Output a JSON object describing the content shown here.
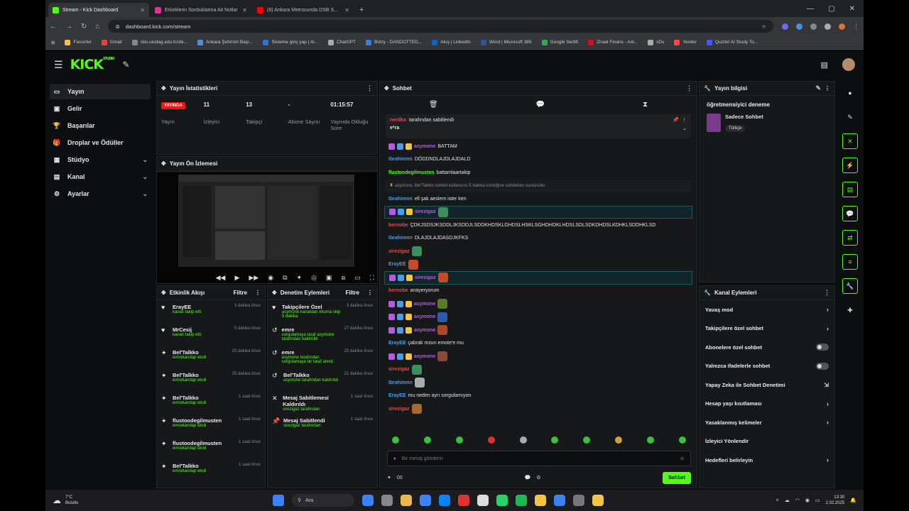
{
  "browser": {
    "tabs": [
      {
        "label": "Stream - Kick Dashboard",
        "color": "#53fc18",
        "active": true
      },
      {
        "label": "Erkeklerin Sorduklarina Ait Notlar",
        "color": "#d43b8a",
        "active": false
      },
      {
        "label": "(8) Ankara Metrosunda DSB S...",
        "color": "#ff0000",
        "active": false
      }
    ],
    "new_tab": "+",
    "url": "dashboard.kick.com/stream",
    "bookmarks": [
      {
        "label": "Favoriler",
        "color": "#f4c542"
      },
      {
        "label": "Gmail",
        "color": "#ea4335"
      },
      {
        "label": "obs.uludag.edu.tr/obi...",
        "color": "#888888"
      },
      {
        "label": "Ankara Şehrinin Başı...",
        "color": "#4a90e2"
      },
      {
        "label": "Sisteme giriş yap | Al...",
        "color": "#2a74d6"
      },
      {
        "label": "ChatGPT",
        "color": "#aaaaaa"
      },
      {
        "label": "Bolzy - DASDOTTED...",
        "color": "#3b7dd8"
      },
      {
        "label": "Akış | LinkedIn",
        "color": "#0a66c2"
      },
      {
        "label": "Word | Microsoft 365",
        "color": "#2b579a"
      },
      {
        "label": "Google Sertifi",
        "color": "#34a853"
      },
      {
        "label": "Ziraat Finans - Anl...",
        "color": "#e30a17"
      },
      {
        "label": "xDs",
        "color": "#aaaaaa"
      },
      {
        "label": "Yeniler",
        "color": "#ff4444"
      },
      {
        "label": "Quizlet AI Study To...",
        "color": "#4255ff"
      }
    ]
  },
  "header": {
    "logo": "KICK",
    "logo_sup": "STUDIO"
  },
  "nav": {
    "items": [
      {
        "label": "Yayın",
        "icon": "▭",
        "active": true,
        "chev": ""
      },
      {
        "label": "Gelir",
        "icon": "▣",
        "active": false,
        "chev": ""
      },
      {
        "label": "Başarılar",
        "icon": "🏆",
        "active": false,
        "chev": ""
      },
      {
        "label": "Droplar ve Ödüller",
        "icon": "🎁",
        "active": false,
        "chev": ""
      },
      {
        "label": "Stüdyo",
        "icon": "▦",
        "active": false,
        "chev": "⌄"
      },
      {
        "label": "Kanal",
        "icon": "▤",
        "active": false,
        "chev": "⌄"
      },
      {
        "label": "Ayarlar",
        "icon": "⚙",
        "active": false,
        "chev": "⌄"
      }
    ]
  },
  "stats": {
    "title": "Yayın İstatistikleri",
    "items": [
      {
        "value": "YAYINDA",
        "label": "Yayın"
      },
      {
        "value": "11",
        "label": "İzleyici"
      },
      {
        "value": "13",
        "label": "Takipçi"
      },
      {
        "value": "-",
        "label": "Abone Sayısı"
      },
      {
        "value": "01:15:57",
        "label": "Yayında Olduğu Süre"
      }
    ]
  },
  "preview": {
    "title": "Yayın Ön İzlemesi"
  },
  "activity": {
    "title": "Etkinlik Akışı",
    "filter": "Filtre",
    "items": [
      {
        "name": "ErayEE",
        "sub": "kanalı takip etti",
        "time": "3 dakika önce",
        "icon": "♥"
      },
      {
        "name": "MrCesij",
        "sub": "kanalı takip etti",
        "time": "5 dakika önce",
        "icon": "♥"
      },
      {
        "name": "Bel'Talkko",
        "sub": "emrekandap ekoli",
        "time": "25 dakika önce",
        "icon": "✦"
      },
      {
        "name": "Bel'Talkko",
        "sub": "emrekandap ekoli",
        "time": "25 dakika önce",
        "icon": "✦"
      },
      {
        "name": "Bel'Talkko",
        "sub": "emrekandap ekoli",
        "time": "1 saat önce",
        "icon": "✦"
      },
      {
        "name": "flustoodegilmusten",
        "sub": "emrekandap ekoli",
        "time": "1 saat önce",
        "icon": "✦"
      },
      {
        "name": "flustoodegilmusten",
        "sub": "emrekandap ekoli",
        "time": "1 saat önce",
        "icon": "✦"
      },
      {
        "name": "Bel'Talkko",
        "sub": "emrekandap ekoli",
        "time": "1 saat önce",
        "icon": "✦"
      }
    ]
  },
  "modact": {
    "title": "Denetim Eylemleri",
    "filter": "Filtre",
    "items": [
      {
        "name": "Takipçilere Özel",
        "sub": "asymone kanaldan okuma skip 5 dakika",
        "time": "3 dakika önce",
        "icon": "♥"
      },
      {
        "name": "emre",
        "sub": "sorgulamaya taraf asymone tarafından kaldırıldı",
        "time": "27 dakika önce",
        "icon": "↺"
      },
      {
        "name": "emre",
        "sub": "asymone tarafından sorgulamaya bir taraf alındı",
        "time": "25 dakika önce",
        "icon": "↺"
      },
      {
        "name": "Bel'Talkko",
        "sub": "asymone tarafından kaldırıldı",
        "time": "21 dakika önce",
        "icon": "↺"
      },
      {
        "name": "Mesaj Sabitlemesi Kaldırıldı",
        "sub": "sirezigaz tarafından",
        "time": "1 saat önce",
        "icon": "✕"
      },
      {
        "name": "Mesaj Sabitlendi",
        "sub": "sirezigaz tarafından",
        "time": "1 saat önce",
        "icon": "📌"
      }
    ]
  },
  "chat": {
    "title": "Sohbet",
    "pinned": {
      "user": "nerdka",
      "text": "tarafından sabitlendi",
      "msg": "e*ra"
    },
    "messages": [
      {
        "user": "asymone",
        "uc": "#b25ce6",
        "text": "BATTAM",
        "type": "n",
        "emote": ""
      },
      {
        "user": "Ibrahimnn",
        "uc": "#4a9de0",
        "text": "DÖDDNDLAJDLAJDALD",
        "type": "n",
        "emote": ""
      },
      {
        "user": "flustoodegilmusten",
        "uc": "#53fc18",
        "text": "battamlaartakip",
        "type": "n",
        "emote": ""
      },
      {
        "user": "",
        "uc": "#888",
        "text": "asymone, Bel'Talkko sohbet kullanıcısı 5 dakika süreliğine sohbetten susturuldu",
        "type": "sys",
        "emote": ""
      },
      {
        "user": "Ibrahimnn",
        "uc": "#4a9de0",
        "text": "ell şak aeslem ister ken",
        "type": "n",
        "emote": ""
      },
      {
        "user": "sirezigaz",
        "uc": "#b25ce6",
        "text": "",
        "type": "hl",
        "emote": "#3c8f5a"
      },
      {
        "user": "bernobe",
        "uc": "#e24b4b",
        "text": "ÇDKJSDSJKSDDLJKSDDJLSDDKHDSKLGHDSLHSKLSGHDHDKLHDSLSDLSDKDHDSLKDHKLSDDHKLSD",
        "type": "n",
        "emote": ""
      },
      {
        "user": "Ibrahimnn",
        "uc": "#4a9de0",
        "text": "DLAJDLAJDASDJKFKS",
        "type": "n",
        "emote": ""
      },
      {
        "user": "sirezigaz",
        "uc": "#e24b4b",
        "text": "",
        "type": "n",
        "emote": "#3c8f5a"
      },
      {
        "user": "ErayEE",
        "uc": "#4a9de0",
        "text": "",
        "type": "n",
        "emote": "#c44a2a"
      },
      {
        "user": "sirezigaz",
        "uc": "#b25ce6",
        "text": "",
        "type": "hl",
        "emote": "#c44a2a"
      },
      {
        "user": "bernobe",
        "uc": "#e24b4b",
        "text": "anayeryorum",
        "type": "n",
        "emote": ""
      },
      {
        "user": "asymone",
        "uc": "#b25ce6",
        "text": "",
        "type": "n",
        "emote": "#5c7a2a"
      },
      {
        "user": "asymone",
        "uc": "#b25ce6",
        "text": "",
        "type": "n",
        "emote": "#2a5ca8"
      },
      {
        "user": "asymone",
        "uc": "#b25ce6",
        "text": "",
        "type": "n",
        "emote": "#a84a2a"
      },
      {
        "user": "ErayEE",
        "uc": "#4a9de0",
        "text": "çabrak mısın emote'e mu",
        "type": "n",
        "emote": ""
      },
      {
        "user": "asymone",
        "uc": "#b25ce6",
        "text": "",
        "type": "n",
        "emote": "#8a4a3a"
      },
      {
        "user": "sirezigaz",
        "uc": "#e24b4b",
        "text": "",
        "type": "n",
        "emote": "#3c8f5a"
      },
      {
        "user": "Ibrahimnn",
        "uc": "#4a9de0",
        "text": "",
        "type": "n",
        "emote": "#aaaaaa"
      },
      {
        "user": "ErayEE",
        "uc": "#4a9de0",
        "text": "mu neden ayrı sorgulamıyon",
        "type": "n",
        "emote": ""
      },
      {
        "user": "sirezigaz",
        "uc": "#e24b4b",
        "text": "",
        "type": "n",
        "emote": "#a86a2a"
      }
    ],
    "emote_colors": [
      "#3cbf3c",
      "#3cbf3c",
      "#3cbf3c",
      "#d33",
      "#aaa",
      "#3cbf3c",
      "#3cbf3c",
      "#c9a23a",
      "#3cbf3c",
      "#3cbf3c"
    ],
    "placeholder": "Bir mesaj gönderin",
    "count": "00",
    "send": "Sohbet"
  },
  "sinfo": {
    "title": "Yayın bilgisi",
    "stream_title": "öğretmensiyici deneme",
    "category": "Sadece Sohbet",
    "tag": "Türkçe"
  },
  "actions": {
    "title": "Kanal Eylemleri",
    "items": [
      {
        "label": "Yavaş mod",
        "ctl": "chev"
      },
      {
        "label": "Takipçilere özel sohbet",
        "ctl": "chev"
      },
      {
        "label": "Abonelere özel sohbet",
        "ctl": "toggle"
      },
      {
        "label": "Yalnızca ifadelerle sohbet",
        "ctl": "toggle"
      },
      {
        "label": "Yapay Zeka ile Sohbet Denetimi",
        "ctl": "ext"
      },
      {
        "label": "Hesap yaşı kısıtlaması",
        "ctl": "chev"
      },
      {
        "label": "Yasaklanmış kelimeler",
        "ctl": "chev"
      },
      {
        "label": "İzleyici Yönlendir",
        "ctl": "none"
      },
      {
        "label": "Hedefleri belirleyin",
        "ctl": "chev"
      }
    ]
  },
  "taskbar": {
    "temp": "7°C",
    "weather": "Bulutlu",
    "search": "Ara",
    "time": "13:30",
    "date": "2.02.2025",
    "app_colors": [
      "#3b82f6",
      "#888",
      "#e8b84a",
      "#3b82f6",
      "#0a84ff",
      "#d33",
      "#ddd",
      "#25d366",
      "#1db954",
      "#f4c542",
      "#3b82f6",
      "#777",
      "#f4c542"
    ]
  }
}
